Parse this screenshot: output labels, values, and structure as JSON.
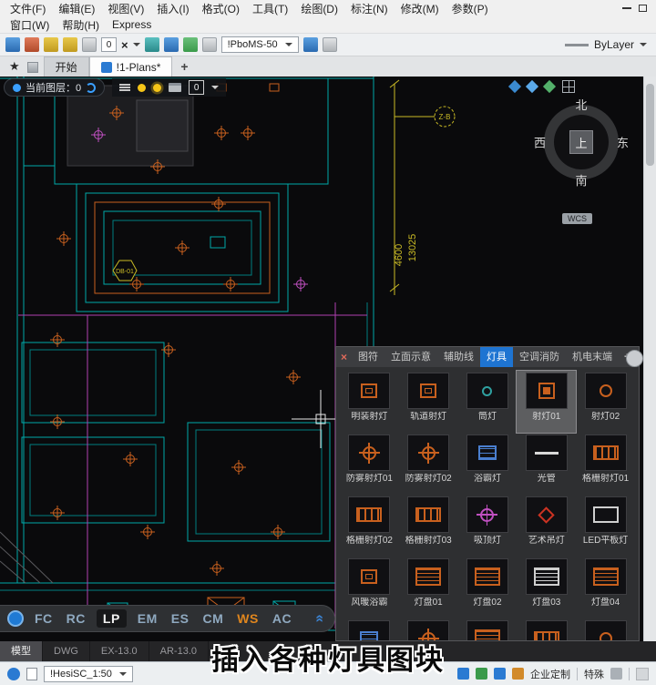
{
  "menu_row1": [
    "文件(F)",
    "编辑(E)",
    "视图(V)",
    "插入(I)",
    "格式(O)",
    "工具(T)",
    "绘图(D)",
    "标注(N)",
    "修改(M)",
    "参数(P)"
  ],
  "menu_row2": [
    "窗口(W)",
    "帮助(H)",
    "Express"
  ],
  "icons": {
    "star": "★",
    "close_x": "×",
    "chevron_double_up": "«"
  },
  "toolbar": {
    "layer_value": "0",
    "style_value": "!PboMS-50",
    "color_value": "ByLayer"
  },
  "tabbar": {
    "start_tab": "开始",
    "drawing_tab": "!1-Plans*",
    "new_tab": "+"
  },
  "layerbar": {
    "current_layer_label": "当前图层：0",
    "layer_value": "0"
  },
  "compass": {
    "north": "北",
    "south": "南",
    "west": "西",
    "east": "东",
    "center": "上",
    "wcs": "WCS"
  },
  "drawing": {
    "dim_1": "4600",
    "dim_2": "13025",
    "axis_bubble": "Z-B",
    "box_label": "DB-01"
  },
  "palette": {
    "tabs": [
      "图符",
      "立面示意",
      "辅助线",
      "灯具",
      "空调消防",
      "机电末端"
    ],
    "active_tab": "灯具",
    "add_tab": "+",
    "selected_item": "射灯01",
    "items": [
      {
        "label": "明装射灯"
      },
      {
        "label": "轨道射灯"
      },
      {
        "label": "筒灯"
      },
      {
        "label": "射灯01"
      },
      {
        "label": "射灯02"
      },
      {
        "label": "防雾射灯01"
      },
      {
        "label": "防雾射灯02"
      },
      {
        "label": "浴霸灯"
      },
      {
        "label": "光管"
      },
      {
        "label": "格栅射灯01"
      },
      {
        "label": "格栅射灯02"
      },
      {
        "label": "格栅射灯03"
      },
      {
        "label": "吸顶灯"
      },
      {
        "label": "艺术吊灯"
      },
      {
        "label": "LED平板灯"
      },
      {
        "label": "风暖浴霸"
      },
      {
        "label": "灯盘01"
      },
      {
        "label": "灯盘02"
      },
      {
        "label": "灯盘03"
      },
      {
        "label": "灯盘04"
      }
    ]
  },
  "quickbar": {
    "buttons": [
      "FC",
      "RC",
      "LP",
      "EM",
      "ES",
      "CM",
      "WS",
      "AC"
    ],
    "active_button": "LP",
    "highlighted_button": "WS"
  },
  "model_tabs": [
    "模型",
    "DWG",
    "EX-13.0",
    "AR-13.0"
  ],
  "statusbar": {
    "scale_value": "!HesiSC_1:50",
    "custom_label": "企业定制",
    "special_label": "特殊"
  },
  "caption": "插入各种灯具图块",
  "colors": {
    "accent_blue": "#1e74d2",
    "cad_cyan": "#00a8a8",
    "cad_orange": "#c8601e",
    "cad_magenta": "#b040b0",
    "cad_yellow": "#c9ba25",
    "quickbar_highlight": "#e0861e"
  }
}
